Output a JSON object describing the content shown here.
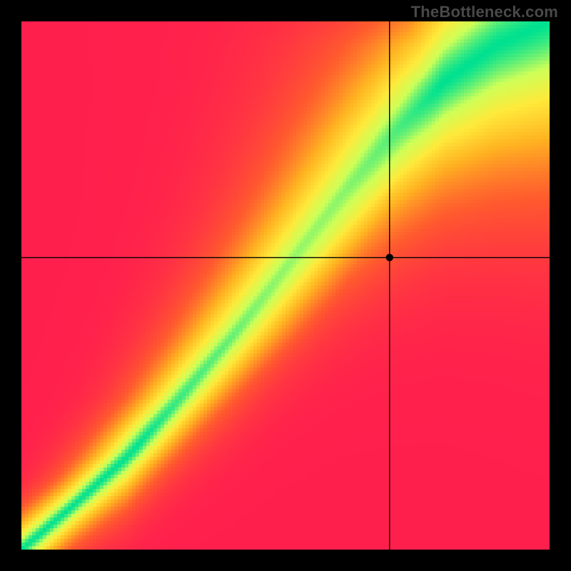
{
  "watermark": "TheBottleneck.com",
  "chart_data": {
    "type": "heatmap",
    "title": "",
    "xlabel": "",
    "ylabel": "",
    "xlim": [
      0,
      1
    ],
    "ylim": [
      0,
      1
    ],
    "colormap": {
      "stops": [
        {
          "pos": 0.0,
          "color": "#ff1f4d"
        },
        {
          "pos": 0.25,
          "color": "#ff5a2e"
        },
        {
          "pos": 0.5,
          "color": "#ffb321"
        },
        {
          "pos": 0.7,
          "color": "#ffe93a"
        },
        {
          "pos": 0.85,
          "color": "#cdff58"
        },
        {
          "pos": 1.0,
          "color": "#00e190"
        }
      ]
    },
    "crosshair": {
      "x": 0.697,
      "y": 0.553
    },
    "point_radius": 5.2,
    "ridge": {
      "description": "Optimal balance ridge; value=1 on ridge, decays with distance and with corner bias.",
      "points": [
        {
          "x": 0.0,
          "y": 0.0,
          "half_width": 0.02
        },
        {
          "x": 0.1,
          "y": 0.085,
          "half_width": 0.02
        },
        {
          "x": 0.2,
          "y": 0.175,
          "half_width": 0.025
        },
        {
          "x": 0.3,
          "y": 0.285,
          "half_width": 0.028
        },
        {
          "x": 0.4,
          "y": 0.405,
          "half_width": 0.034
        },
        {
          "x": 0.5,
          "y": 0.535,
          "half_width": 0.04
        },
        {
          "x": 0.6,
          "y": 0.665,
          "half_width": 0.048
        },
        {
          "x": 0.7,
          "y": 0.785,
          "half_width": 0.058
        },
        {
          "x": 0.8,
          "y": 0.885,
          "half_width": 0.068
        },
        {
          "x": 0.9,
          "y": 0.955,
          "half_width": 0.08
        },
        {
          "x": 1.0,
          "y": 1.0,
          "half_width": 0.09
        }
      ]
    },
    "corner_bias": {
      "top_left": {
        "weight": 0.85,
        "radius": 0.8
      },
      "bottom_right": {
        "weight": 0.85,
        "radius": 0.8
      }
    },
    "resolution": 148
  }
}
